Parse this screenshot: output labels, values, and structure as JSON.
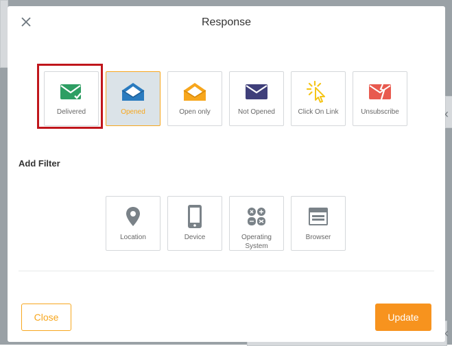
{
  "modal": {
    "title": "Response"
  },
  "response_options": [
    {
      "label": "Delivered",
      "icon": "envelope-check-icon",
      "color": "#2e9e63",
      "selected": false,
      "highlighted": true
    },
    {
      "label": "Opened",
      "icon": "envelope-open-icon",
      "color": "#2a7bbf",
      "selected": true,
      "highlighted": false
    },
    {
      "label": "Open only",
      "icon": "envelope-open-icon",
      "color": "#f7a61c",
      "selected": false,
      "highlighted": false
    },
    {
      "label": "Not Opened",
      "icon": "envelope-closed-icon",
      "color": "#3f3f7a",
      "selected": false,
      "highlighted": false
    },
    {
      "label": "Click On Link",
      "icon": "cursor-click-icon",
      "color": "#f5c518",
      "selected": false,
      "highlighted": false
    },
    {
      "label": "Unsubscribe",
      "icon": "envelope-broken-icon",
      "color": "#e85a4f",
      "selected": false,
      "highlighted": false
    }
  ],
  "filters": {
    "title": "Add Filter",
    "items": [
      {
        "label": "Location",
        "icon": "map-pin-icon"
      },
      {
        "label": "Device",
        "icon": "mobile-device-icon"
      },
      {
        "label": "Operating\nSystem",
        "icon": "os-icon"
      },
      {
        "label": "Browser",
        "icon": "browser-window-icon"
      }
    ]
  },
  "footer": {
    "close_label": "Close",
    "update_label": "Update"
  },
  "colors": {
    "accent": "#f7931e",
    "highlight": "#c0151b",
    "icon_gray": "#7a8288"
  }
}
